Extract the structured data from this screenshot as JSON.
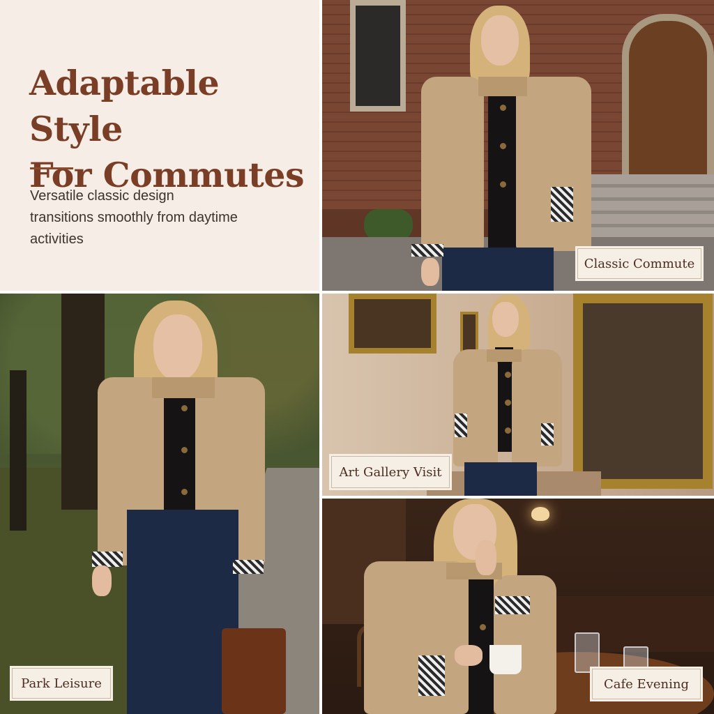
{
  "intro": {
    "headline_line1": "Adaptable Style",
    "headline_line2": "For Commutes",
    "body": "Versatile classic design transitions smoothly from daytime activities"
  },
  "panels": {
    "classic": {
      "caption": "Classic Commute",
      "icon": "campus-scene"
    },
    "park": {
      "caption": "Park Leisure",
      "icon": "park-scene"
    },
    "gallery": {
      "caption": "Art Gallery Visit",
      "icon": "gallery-scene"
    },
    "cafe": {
      "caption": "Cafe Evening",
      "icon": "cafe-scene"
    }
  },
  "colors": {
    "headline": "#7a3e26",
    "background_panel": "#f6eee6",
    "coat": "#c3a57f",
    "caption_text": "#4a2d20"
  }
}
